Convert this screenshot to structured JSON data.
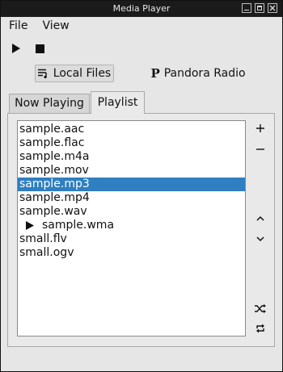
{
  "window": {
    "title": "Media Player"
  },
  "menu": {
    "file": "File",
    "view": "View"
  },
  "toolbar": {
    "play_icon": "play-icon",
    "stop_icon": "stop-icon"
  },
  "sources": {
    "local": {
      "label": "Local Files",
      "icon": "playlist-icon"
    },
    "pandora": {
      "label": "Pandora Radio",
      "icon": "P"
    }
  },
  "tabs": [
    {
      "label": "Now Playing",
      "active": false
    },
    {
      "label": "Playlist",
      "active": true
    }
  ],
  "playlist": {
    "items": [
      "sample.aac",
      "sample.flac",
      "sample.m4a",
      "sample.mov",
      "sample.mp3",
      "sample.mp4",
      "sample.wav",
      "sample.wma",
      "small.flv",
      "small.ogv"
    ],
    "selected": "sample.mp3",
    "playing": "sample.wma"
  },
  "side_buttons": [
    "add-icon",
    "remove-icon",
    "move-up-icon",
    "move-down-icon",
    "shuffle-icon",
    "repeat-icon"
  ],
  "colors": {
    "selection": "#2f7fc1",
    "titlebar": "#1b1b1b"
  }
}
